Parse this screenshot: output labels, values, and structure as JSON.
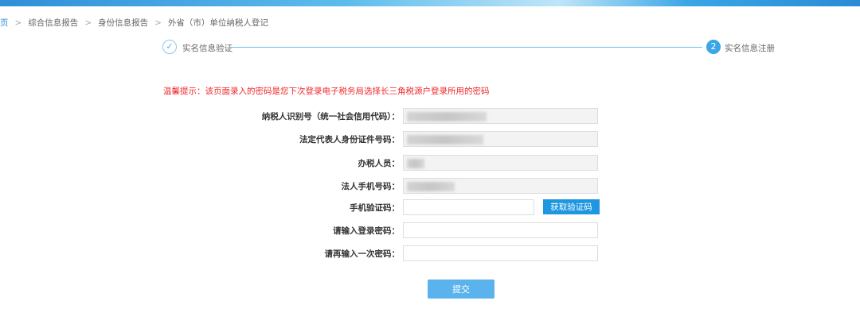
{
  "breadcrumb": [
    "页",
    "综合信息报告",
    "身份信息报告",
    "外省（市）单位纳税人登记"
  ],
  "breadcrumb_sep": ">",
  "steps": [
    {
      "label": "实名信息验证",
      "icon": "check-icon",
      "status": "done"
    },
    {
      "label": "实名信息注册",
      "number": "2",
      "status": "active"
    }
  ],
  "warning": "温馨提示：该页面录入的密码是您下次登录电子税务局选择长三角税源户登录所用的密码",
  "form": {
    "taxpayer_id_label": "纳税人识别号（统一社会信用代码）：",
    "legal_id_label": "法定代表人身份证件号码：",
    "handler_label": "办税人员：",
    "legal_phone_label": "法人手机号码：",
    "sms_code_label": "手机验证码：",
    "get_code_button": "获取验证码",
    "password_label": "请输入登录密码：",
    "password_confirm_label": "请再输入一次密码："
  },
  "submit_label": "提交",
  "colors": {
    "accent": "#1e97e0",
    "warning": "#f0282d",
    "submit": "#5ab3ec"
  }
}
